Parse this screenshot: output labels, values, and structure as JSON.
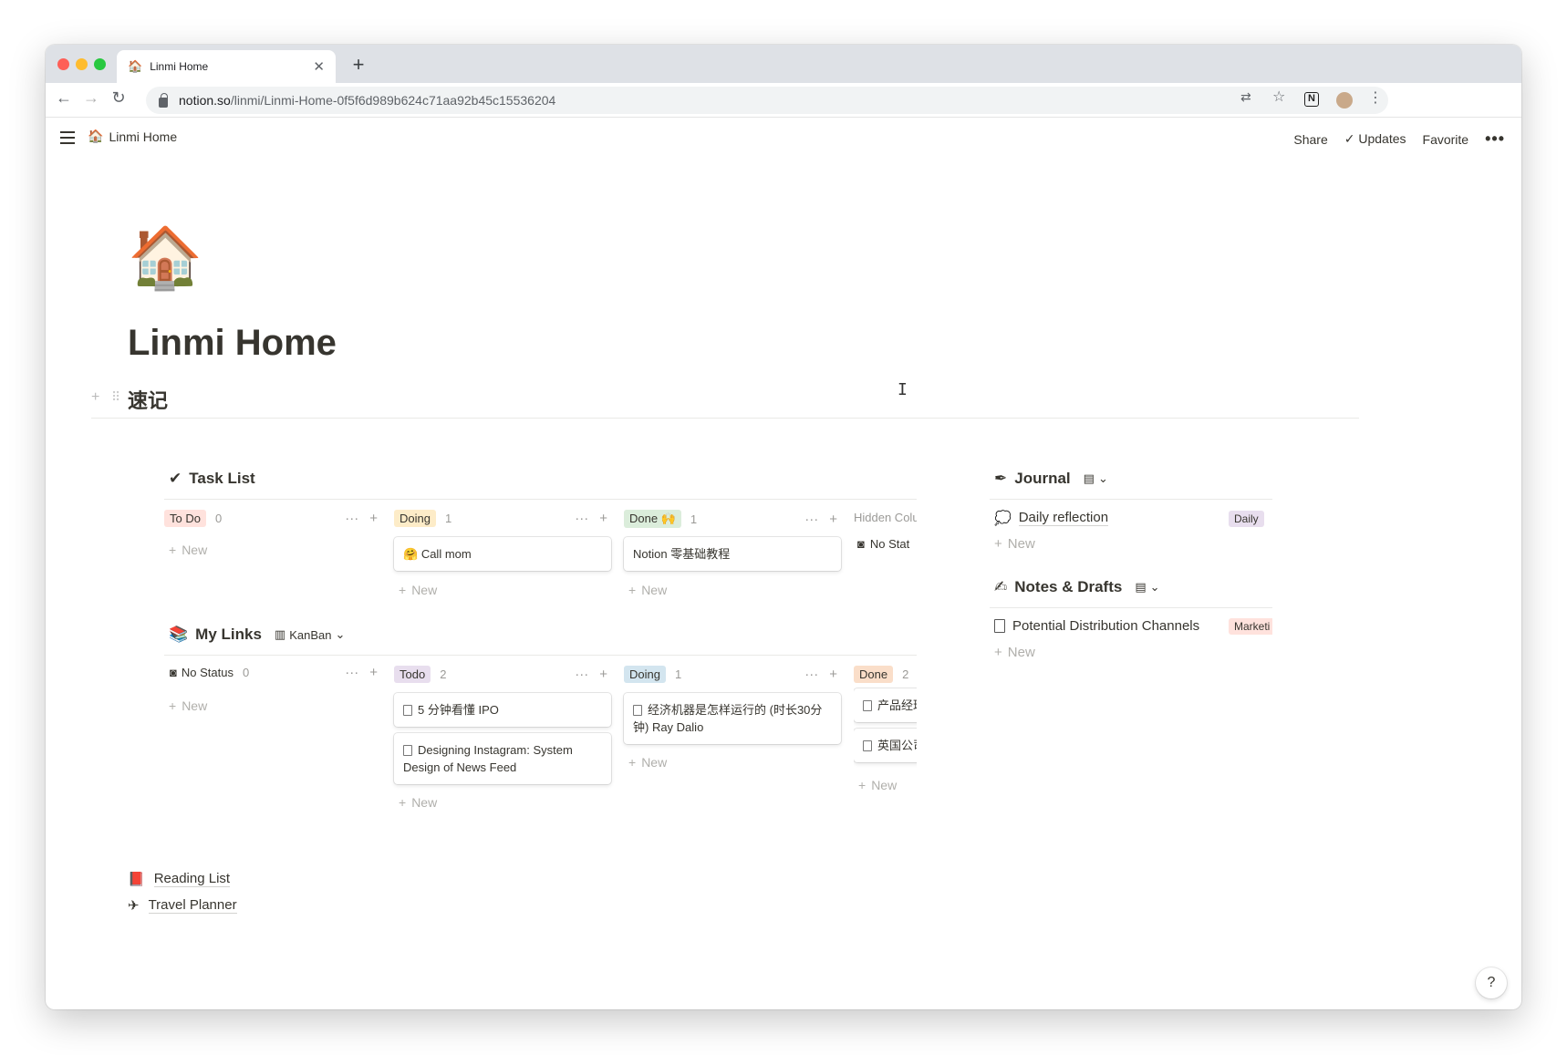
{
  "browser": {
    "tab_title": "Linmi Home",
    "tab_favicon": "🏠",
    "url_host": "notion.so",
    "url_path": "/linmi/Linmi-Home-0f5f6d989b624c71aa92b45c15536204"
  },
  "header": {
    "breadcrumb_icon": "🏠",
    "breadcrumb": "Linmi Home",
    "share": "Share",
    "updates": "Updates",
    "favorite": "Favorite"
  },
  "page": {
    "icon": "🏠",
    "title": "Linmi Home",
    "heading": "速记"
  },
  "task_list": {
    "icon": "✔",
    "title": "Task List",
    "columns": [
      {
        "label": "To Do",
        "count": "0",
        "color": "#ffe2dd"
      },
      {
        "label": "Doing",
        "count": "1",
        "color": "#fdecc8"
      },
      {
        "label": "Done 🙌",
        "count": "1",
        "color": "#dbeddb"
      }
    ],
    "hidden_label": "Hidden Colu",
    "hidden_item": "No Stat",
    "cards": {
      "doing": [
        {
          "icon": "🤗",
          "text": "Call mom"
        }
      ],
      "done": [
        {
          "text": "Notion 零基础教程"
        }
      ]
    },
    "new_label": "New"
  },
  "my_links": {
    "icon": "📚",
    "title": "My Links",
    "view": "KanBan",
    "columns": [
      {
        "label": "No Status",
        "count": "0"
      },
      {
        "label": "Todo",
        "count": "2",
        "color": "#e8deee"
      },
      {
        "label": "Doing",
        "count": "1",
        "color": "#d3e5ef"
      },
      {
        "label": "Done",
        "count": "2",
        "color": "#fadec9"
      }
    ],
    "cards": {
      "todo": [
        "5 分钟看懂 IPO",
        "Designing Instagram: System Design of News Feed"
      ],
      "doing": [
        "经济机器是怎样运行的 (时长30分钟) Ray Dalio"
      ],
      "done": [
        "产品经理",
        "英国公司"
      ]
    },
    "new_label": "New"
  },
  "journal": {
    "icon": "✒",
    "title": "Journal",
    "item_icon": "💭",
    "item": "Daily reflection",
    "tag": "Daily",
    "tag_color": "#e8deee",
    "new_label": "New"
  },
  "notes": {
    "icon": "✍",
    "title": "Notes & Drafts",
    "item": "Potential Distribution Channels",
    "tag": "Marketi",
    "tag_color": "#ffe2dd",
    "new_label": "New"
  },
  "bottom_links": [
    {
      "icon": "📕",
      "label": "Reading List"
    },
    {
      "icon": "✈",
      "label": "Travel Planner"
    }
  ],
  "help": "?"
}
